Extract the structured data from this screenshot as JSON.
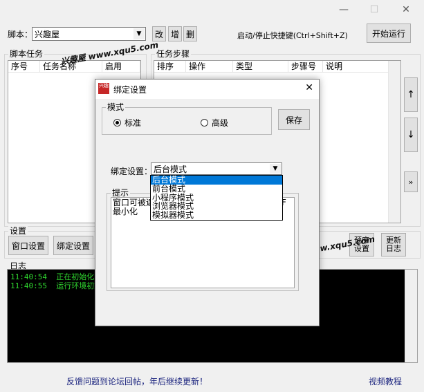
{
  "titlebar": {
    "minimize": "—",
    "maximize": "☐",
    "close": "✕"
  },
  "toolbar": {
    "script_label": "脚本：",
    "script_value": "兴趣屋",
    "edit_btn": "改",
    "add_btn": "增",
    "delete_btn": "删",
    "hotkey_text": "启动/停止快捷键(Ctrl+Shift+Z)",
    "start_btn": "开始运行"
  },
  "script_tasks": {
    "label": "脚本任务",
    "columns": [
      "序号",
      "任务名称",
      "启用"
    ]
  },
  "task_steps": {
    "label": "任务步骤",
    "columns": [
      "排序",
      "操作",
      "类型",
      "步骤号",
      "说明"
    ],
    "up_btn": "↑",
    "down_btn": "↓",
    "more_btn": "»"
  },
  "settings": {
    "label": "设置",
    "window_btn": "窗口设置",
    "bind_btn": "绑定设置",
    "sort_btn": "预序设置",
    "update_btn": "更新日志"
  },
  "log": {
    "label": "日志",
    "lines": [
      {
        "time": "11:40:54",
        "msg": "正在初始化"
      },
      {
        "time": "11:40:55",
        "msg": "运行环境初始"
      }
    ]
  },
  "footer": {
    "feedback": "反馈问题到论坛回帖，年后继续更新！",
    "tutorial": "视频教程"
  },
  "watermarks": {
    "top": "兴趣屋 www.xqu5.com",
    "bottom": "兴趣屋 www.xqu5.com"
  },
  "dialog": {
    "title": "绑定设置",
    "close": "✕",
    "mode_label": "模式",
    "mode_standard": "标准",
    "mode_advanced": "高级",
    "save_btn": "保存",
    "bind_label": "绑定设置：",
    "bind_value": "后台模式",
    "tip_label": "提示",
    "tip_line1": "窗口可被遮",
    "tip_line1_tail": "F",
    "tip_line2": "最小化",
    "options": [
      "后台模式",
      "前台模式",
      "小程序模式",
      "浏览器模式",
      "模拟器模式"
    ]
  },
  "colors": {
    "accent": "#0078d7",
    "log_text": "#2fd52f",
    "link": "#1a237e"
  }
}
